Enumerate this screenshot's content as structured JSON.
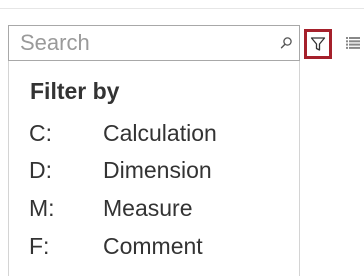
{
  "search": {
    "placeholder": "Search",
    "icon": "search-icon"
  },
  "toolbar": {
    "filter_icon": "filter-icon",
    "list_icon": "list-view-icon",
    "accent_color": "#a5202b"
  },
  "filter_menu": {
    "title": "Filter by",
    "options": [
      {
        "key": "C:",
        "label": "Calculation"
      },
      {
        "key": "D:",
        "label": "Dimension"
      },
      {
        "key": "M:",
        "label": "Measure"
      },
      {
        "key": "F:",
        "label": "Comment"
      }
    ]
  }
}
